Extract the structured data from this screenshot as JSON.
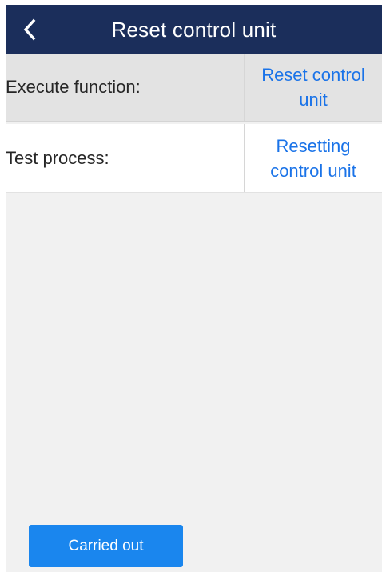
{
  "header": {
    "title": "Reset control unit",
    "back_icon": "chevron-left-icon"
  },
  "rows": [
    {
      "label": "Execute function:",
      "value": "Reset control unit"
    },
    {
      "label": "Test process:",
      "value": "Resetting control unit"
    }
  ],
  "action_button": {
    "label": "Carried out"
  },
  "colors": {
    "header_bg": "#1b2e5b",
    "value_text": "#1a73e8",
    "button_bg": "#1a86ee",
    "background": "#f1f1f1"
  }
}
